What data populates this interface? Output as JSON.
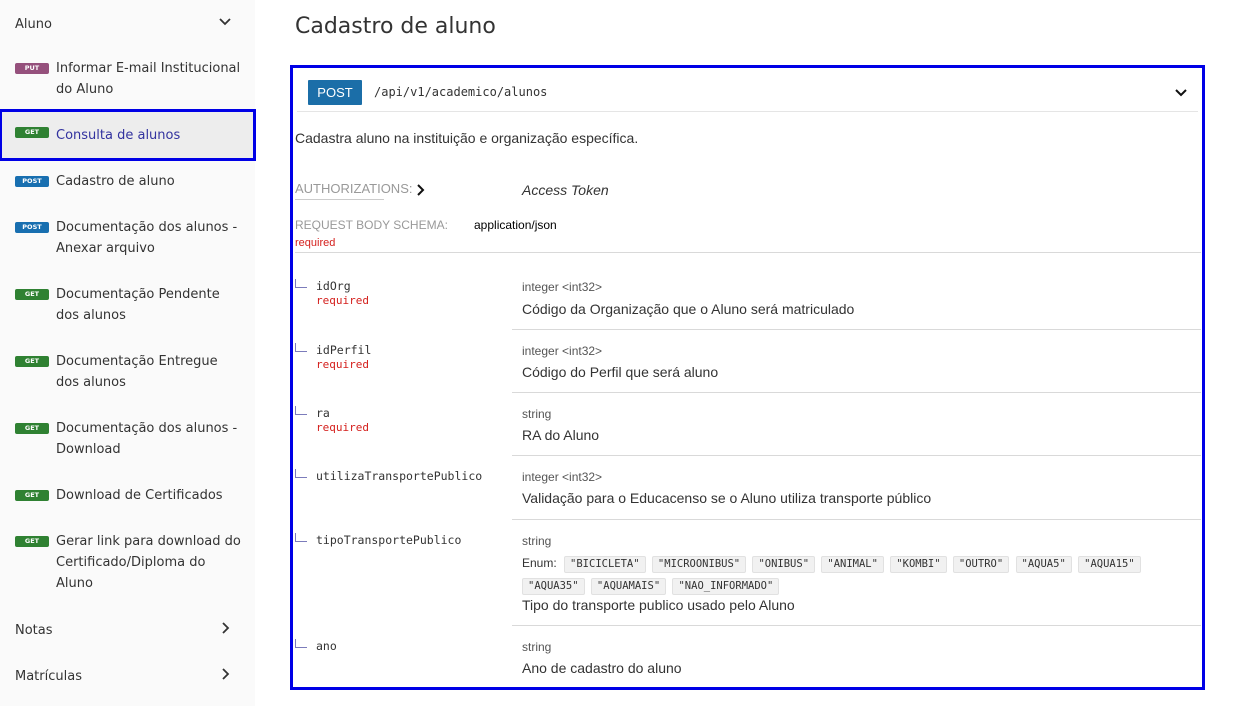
{
  "sidebar": {
    "groups": [
      {
        "label": "Aluno",
        "state": "expanded"
      },
      {
        "label": "Notas",
        "state": "collapsed"
      },
      {
        "label": "Matrículas",
        "state": "collapsed"
      }
    ],
    "items": [
      {
        "method": "PUT",
        "label": "Informar E-mail Institucional do Aluno"
      },
      {
        "method": "GET",
        "label": "Consulta de alunos",
        "active": true
      },
      {
        "method": "POST",
        "label": "Cadastro de aluno"
      },
      {
        "method": "POST",
        "label": "Documentação dos alunos - Anexar arquivo"
      },
      {
        "method": "GET",
        "label": "Documentação Pendente dos alunos"
      },
      {
        "method": "GET",
        "label": "Documentação Entregue dos alunos"
      },
      {
        "method": "GET",
        "label": "Documentação dos alunos - Download"
      },
      {
        "method": "GET",
        "label": "Download de Certificados"
      },
      {
        "method": "GET",
        "label": "Gerar link para download do Certificado/Diploma do Aluno"
      }
    ]
  },
  "main": {
    "title": "Cadastro de aluno",
    "endpoint": {
      "method": "POST",
      "path": "/api/v1/academico/alunos"
    },
    "description": "Cadastra aluno na instituição e organização específica.",
    "authorizations": {
      "label": "AUTHORIZATIONS:",
      "value": "Access Token"
    },
    "request_body": {
      "label": "REQUEST BODY SCHEMA:",
      "content_type": "application/json",
      "required": "required"
    },
    "properties": [
      {
        "name": "idOrg",
        "required": "required",
        "type": "integer <int32>",
        "description": "Código da Organização que o Aluno será matriculado"
      },
      {
        "name": "idPerfil",
        "required": "required",
        "type": "integer <int32>",
        "description": "Código do Perfil que será aluno"
      },
      {
        "name": "ra",
        "required": "required",
        "type": "string",
        "description": "RA do Aluno"
      },
      {
        "name": "utilizaTransportePublico",
        "type": "integer <int32>",
        "description": "Validação para o Educacenso se o Aluno utiliza transporte público"
      },
      {
        "name": "tipoTransportePublico",
        "type": "string",
        "enum_label": "Enum:",
        "enum": [
          "\"BICICLETA\"",
          "\"MICROONIBUS\"",
          "\"ONIBUS\"",
          "\"ANIMAL\"",
          "\"KOMBI\"",
          "\"OUTRO\"",
          "\"AQUA5\"",
          "\"AQUA15\"",
          "\"AQUA35\"",
          "\"AQUAMAIS\"",
          "\"NAO_INFORMADO\""
        ],
        "description": "Tipo do transporte publico usado pelo Aluno"
      },
      {
        "name": "ano",
        "type": "string",
        "description": "Ano de cadastro do aluno"
      }
    ]
  },
  "colors": {
    "put": "#95507c",
    "get": "#2f8132",
    "post": "#186fb0",
    "accent": "#32329f",
    "required": "#d41f1c",
    "highlight": "#0000e6"
  },
  "icons": [
    "chevron-down-icon",
    "chevron-right-icon"
  ]
}
